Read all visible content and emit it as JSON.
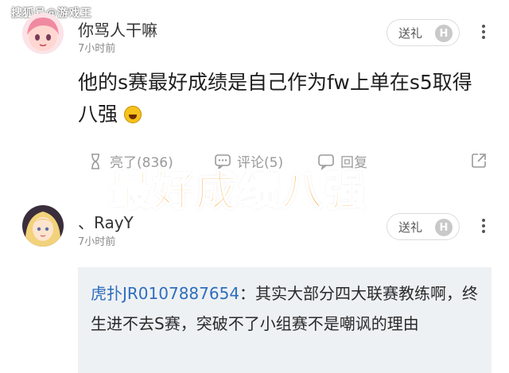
{
  "watermark": "搜狐号@游戏王",
  "comments": [
    {
      "username": "你骂人干嘛",
      "time": "7小时前",
      "gift_label": "送礼",
      "gift_badge": "H",
      "text": "他的s赛最好成绩是自己作为fw上单在s5取得八强",
      "actions": {
        "like": "亮了(836)",
        "comment": "评论(5)",
        "reply": "回复"
      }
    },
    {
      "username": "、RayY",
      "time": "7小时前",
      "gift_label": "送礼",
      "gift_badge": "H",
      "quote_user": "虎扑JR0107887654",
      "quote_text": "：其实大部分四大联赛教练啊，终生进不去S赛，突破不了小组赛不是嘲讽的理由"
    }
  ],
  "overlay_caption": "最好成绩八强",
  "colors": {
    "overlay": "#f79b1b",
    "quote_user": "#2f6ebd",
    "quote_bg": "#eef1f4"
  },
  "icons": [
    "avatar-anime-girl",
    "avatar-blonde-girl",
    "h-badge-icon",
    "more-vertical-icon",
    "light-bulb-icon",
    "comment-icon",
    "reply-icon",
    "share-icon",
    "laughing-face-emoji"
  ]
}
